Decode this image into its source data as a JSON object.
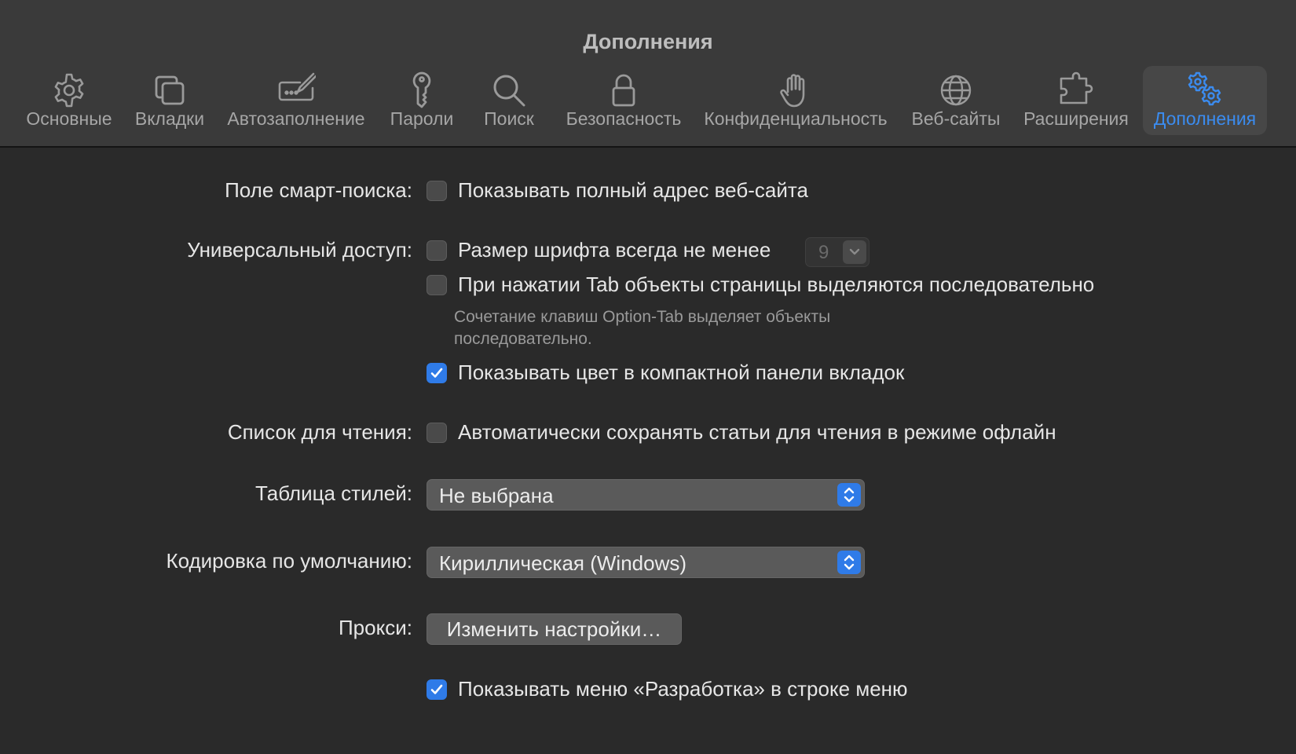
{
  "window": {
    "title": "Дополнения"
  },
  "toolbar": {
    "tabs": [
      {
        "label": "Основные",
        "icon": "gear-icon"
      },
      {
        "label": "Вкладки",
        "icon": "tabs-icon"
      },
      {
        "label": "Автозаполнение",
        "icon": "autofill-icon"
      },
      {
        "label": "Пароли",
        "icon": "key-icon"
      },
      {
        "label": "Поиск",
        "icon": "search-icon"
      },
      {
        "label": "Безопасность",
        "icon": "lock-icon"
      },
      {
        "label": "Конфиденциальность",
        "icon": "hand-icon"
      },
      {
        "label": "Веб-сайты",
        "icon": "globe-icon"
      },
      {
        "label": "Расширения",
        "icon": "puzzle-icon"
      },
      {
        "label": "Дополнения",
        "icon": "gears-icon",
        "active": true
      }
    ]
  },
  "colors": {
    "accent": "#2f7be8",
    "active_tab_text": "#3b8cf0",
    "background": "#2a2a2a",
    "titlebar": "#3a3a3a"
  },
  "settings": {
    "smart_search": {
      "label": "Поле смарт-поиска:",
      "show_full_address": {
        "text": "Показывать полный адрес веб-сайта",
        "checked": false
      }
    },
    "accessibility": {
      "label": "Универсальный доступ:",
      "min_font_size": {
        "text": "Размер шрифта всегда не менее",
        "checked": false,
        "value": "9"
      },
      "tab_highlight": {
        "text": "При нажатии Tab объекты страницы выделяются последовательно",
        "checked": false
      },
      "hint": "Сочетание клавиш Option-Tab выделяет объекты последовательно.",
      "show_color": {
        "text": "Показывать цвет в компактной панели вкладок",
        "checked": true
      }
    },
    "reading_list": {
      "label": "Список для чтения:",
      "save_offline": {
        "text": "Автоматически сохранять статьи для чтения в режиме офлайн",
        "checked": false
      }
    },
    "style_sheet": {
      "label": "Таблица стилей:",
      "value": "Не выбрана"
    },
    "encoding": {
      "label": "Кодировка по умолчанию:",
      "value": "Кириллическая (Windows)"
    },
    "proxies": {
      "label": "Прокси:",
      "button": "Изменить настройки…"
    },
    "develop_menu": {
      "text": "Показывать меню «Разработка» в строке меню",
      "checked": true
    }
  }
}
